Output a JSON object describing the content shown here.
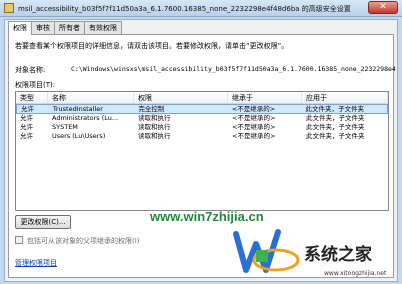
{
  "window": {
    "title": "msil_accessibility_b03f5f7f11d50a3a_6.1.7600.16385_none_2232298e4f48d6ba 的高级安全设置",
    "close_label": "✕"
  },
  "tabs": [
    {
      "label": "权限",
      "active": true
    },
    {
      "label": "审核",
      "active": false
    },
    {
      "label": "所有者",
      "active": false
    },
    {
      "label": "有效权限",
      "active": false
    }
  ],
  "panel": {
    "description": "若要查看某个权限项目的详细信息，请双击该项目。若要修改权限，请单击“更改权限”。",
    "object_name_label": "对象名称:",
    "object_name_value": "C:\\Windows\\winsxs\\msil_accessibility_b03f5f7f11d50a3a_6.1.7600.16385_none_2232298e4",
    "permission_entries_label": "权限项目(T):",
    "columns": [
      "类型",
      "名称",
      "权限",
      "继承于",
      "应用于"
    ],
    "rows": [
      {
        "type": "允许",
        "name": "TrustedInstaller",
        "permission": "完全控制",
        "inherited_from": "<不是继承的>",
        "applies_to": "此文件夹，子文件夹",
        "selected": true
      },
      {
        "type": "允许",
        "name": "Administrators (Lu...",
        "permission": "读取和执行",
        "inherited_from": "<不是继承的>",
        "applies_to": "此文件夹，子文件夹",
        "selected": false
      },
      {
        "type": "允许",
        "name": "SYSTEM",
        "permission": "读取和执行",
        "inherited_from": "<不是继承的>",
        "applies_to": "此文件夹，子文件夹",
        "selected": false
      },
      {
        "type": "允许",
        "name": "Users (Lu\\Users)",
        "permission": "读取和执行",
        "inherited_from": "<不是继承的>",
        "applies_to": "此文件夹，子文件夹",
        "selected": false
      }
    ],
    "change_button": "更改权限(C)...",
    "inherit_checkbox_label": "包括可从该对象的父项继承的权限(I)",
    "manage_link": "管理权限项目"
  },
  "watermark": {
    "site": "www.win7zhijia.cn",
    "logo_text": "系统之家",
    "logo_url": "www.xitongzhijia.net"
  },
  "colors": {
    "selection": "#cde8ff",
    "link": "#0645ad",
    "watermark_green": "#1f8a3c"
  }
}
